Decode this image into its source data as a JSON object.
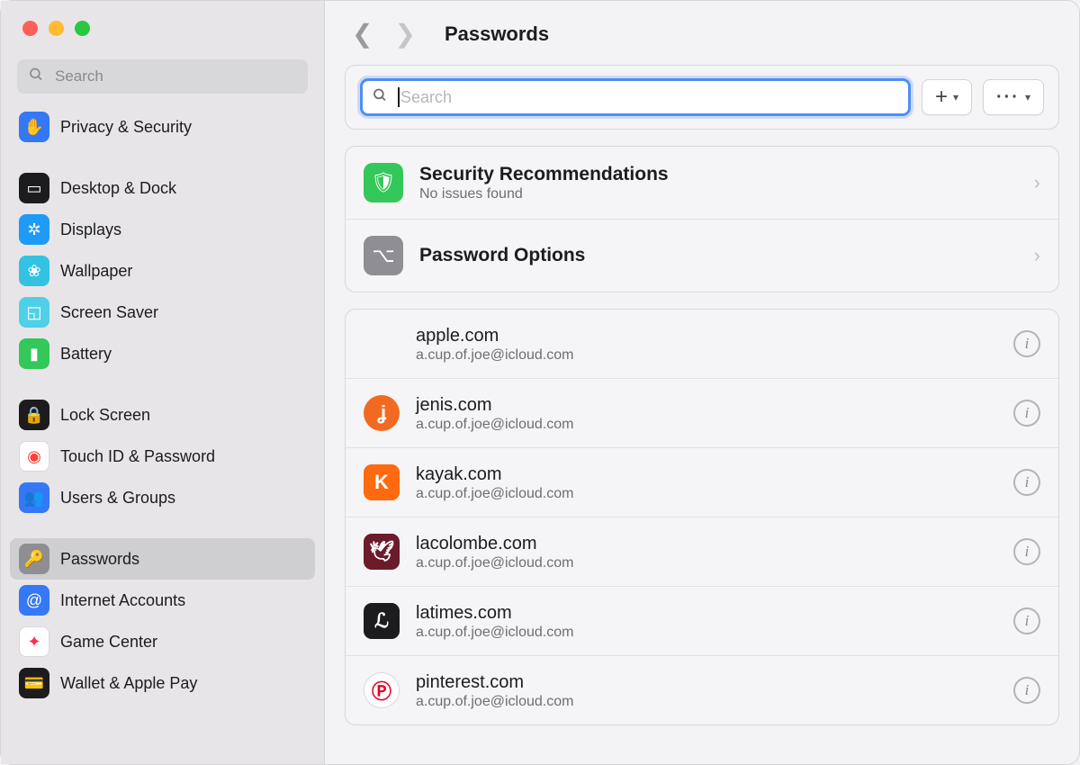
{
  "header": {
    "title": "Passwords"
  },
  "sidebar": {
    "search_placeholder": "Search",
    "groups": [
      {
        "items": [
          {
            "label": "Privacy & Security",
            "icon_name": "hand-icon",
            "bg": "#3478f6",
            "glyph": "✋"
          }
        ]
      },
      {
        "items": [
          {
            "label": "Desktop & Dock",
            "icon_name": "desktop-icon",
            "bg": "#1c1c1e",
            "glyph": "▭"
          },
          {
            "label": "Displays",
            "icon_name": "displays-icon",
            "bg": "#1d9bf6",
            "glyph": "✲"
          },
          {
            "label": "Wallpaper",
            "icon_name": "wallpaper-icon",
            "bg": "#34c2e3",
            "glyph": "❀"
          },
          {
            "label": "Screen Saver",
            "icon_name": "screensaver-icon",
            "bg": "#4fd0e7",
            "glyph": "◱"
          },
          {
            "label": "Battery",
            "icon_name": "battery-icon",
            "bg": "#34c759",
            "glyph": "▮"
          }
        ]
      },
      {
        "items": [
          {
            "label": "Lock Screen",
            "icon_name": "lock-screen-icon",
            "bg": "#1c1c1e",
            "glyph": "🔒"
          },
          {
            "label": "Touch ID & Password",
            "icon_name": "touchid-icon",
            "bg": "#ffffff",
            "glyph": "◉",
            "fg": "#ff4037",
            "border": true
          },
          {
            "label": "Users & Groups",
            "icon_name": "users-icon",
            "bg": "#3478f6",
            "glyph": "👥"
          }
        ]
      },
      {
        "items": [
          {
            "label": "Passwords",
            "icon_name": "passwords-icon",
            "bg": "#8e8e93",
            "glyph": "🔑",
            "selected": true
          },
          {
            "label": "Internet Accounts",
            "icon_name": "at-icon",
            "bg": "#3478f6",
            "glyph": "@"
          },
          {
            "label": "Game Center",
            "icon_name": "gamecenter-icon",
            "bg": "#ffffff",
            "glyph": "✦",
            "fg": "#ff2d55",
            "border": true
          },
          {
            "label": "Wallet & Apple Pay",
            "icon_name": "wallet-icon",
            "bg": "#1c1c1e",
            "glyph": "💳"
          }
        ]
      }
    ]
  },
  "main_search": {
    "placeholder": "Search"
  },
  "buttons": {
    "add": "+",
    "more": "···"
  },
  "settings_rows": [
    {
      "title": "Security Recommendations",
      "subtitle": "No issues found",
      "icon_name": "shield-check-icon",
      "bg": "#34c759",
      "glyph": "🛡"
    },
    {
      "title": "Password Options",
      "subtitle": "",
      "icon_name": "switches-icon",
      "bg": "#8e8e93",
      "glyph": "⌥"
    }
  ],
  "entries": [
    {
      "site": "apple.com",
      "user": "a.cup.of.joe@icloud.com",
      "icon_name": "apple-logo-icon",
      "bg": "transparent",
      "fg": "#6e6e73",
      "glyph": ""
    },
    {
      "site": "jenis.com",
      "user": "a.cup.of.joe@icloud.com",
      "icon_name": "jenis-logo-icon",
      "bg": "#f26a21",
      "fg": "#ffffff",
      "glyph": "ʝ",
      "round": true
    },
    {
      "site": "kayak.com",
      "user": "a.cup.of.joe@icloud.com",
      "icon_name": "kayak-logo-icon",
      "bg": "#ff690f",
      "fg": "#ffffff",
      "glyph": "K"
    },
    {
      "site": "lacolombe.com",
      "user": "a.cup.of.joe@icloud.com",
      "icon_name": "lacolombe-logo-icon",
      "bg": "#6b1b2a",
      "fg": "#ffffff",
      "glyph": "🕊"
    },
    {
      "site": "latimes.com",
      "user": "a.cup.of.joe@icloud.com",
      "icon_name": "latimes-logo-icon",
      "bg": "#1c1c1e",
      "fg": "#ffffff",
      "glyph": "ℒ"
    },
    {
      "site": "pinterest.com",
      "user": "a.cup.of.joe@icloud.com",
      "icon_name": "pinterest-logo-icon",
      "bg": "#ffffff",
      "fg": "#e60023",
      "glyph": "Ⓟ",
      "border": true,
      "round": true
    }
  ]
}
